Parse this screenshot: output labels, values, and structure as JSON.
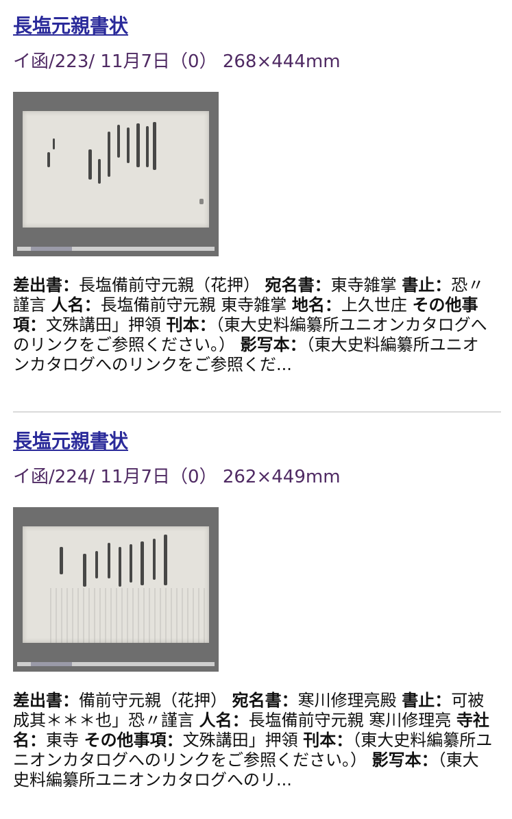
{
  "records": [
    {
      "title": "長塩元親書状",
      "meta": "イ函/223/ 11月7日（0） 268×444mm",
      "image_alt": "古文書画像",
      "fields": [
        {
          "label": "差出書：",
          "value": "長塩備前守元親（花押） "
        },
        {
          "label": "宛名書：",
          "value": "東寺雑掌 "
        },
        {
          "label": "書止：",
          "value": "恐〃謹言 "
        },
        {
          "label": "人名：",
          "value": "長塩備前守元親 東寺雑掌 "
        },
        {
          "label": "地名：",
          "value": "上久世庄 "
        },
        {
          "label": "その他事項：",
          "value": "文殊講田」押領 "
        },
        {
          "label": "刊本：",
          "value": "（東大史料編纂所ユニオンカタログへのリンクをご参照ください。） "
        },
        {
          "label": "影写本：",
          "value": "（東大史料編纂所ユニオンカタログへのリンクをご参照くだ..."
        }
      ]
    },
    {
      "title": "長塩元親書状",
      "meta": "イ函/224/ 11月7日（0） 262×449mm",
      "image_alt": "古文書画像",
      "fields": [
        {
          "label": "差出書：",
          "value": "備前守元親（花押） "
        },
        {
          "label": "宛名書：",
          "value": "寒川修理亮殿 "
        },
        {
          "label": "書止：",
          "value": "可被成其＊＊＊也」恐〃謹言 "
        },
        {
          "label": "人名：",
          "value": "長塩備前守元親 寒川修理亮 "
        },
        {
          "label": "寺社名：",
          "value": "東寺 "
        },
        {
          "label": "その他事項：",
          "value": "文殊講田」押領 "
        },
        {
          "label": "刊本：",
          "value": "（東大史料編纂所ユニオンカタログへのリンクをご参照ください。） "
        },
        {
          "label": "影写本：",
          "value": "（東大史料編纂所ユニオンカタログへのリ..."
        }
      ]
    }
  ]
}
